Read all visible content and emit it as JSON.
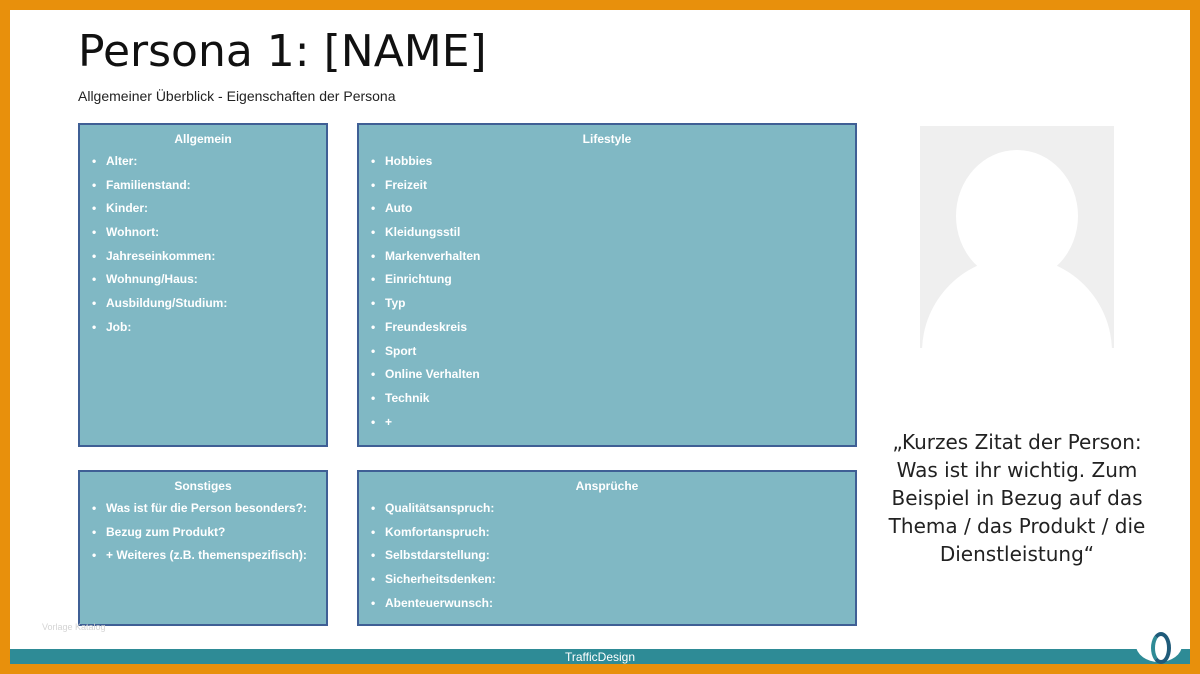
{
  "title": "Persona 1: [NAME]",
  "subtitle": "Allgemeiner Überblick - Eigenschaften der Persona",
  "boxes": {
    "allgemein": {
      "title": "Allgemein",
      "items": [
        "Alter:",
        "Familienstand:",
        "Kinder:",
        "Wohnort:",
        "Jahreseinkommen:",
        "Wohnung/Haus:",
        "Ausbildung/Studium:",
        "Job:"
      ]
    },
    "lifestyle": {
      "title": "Lifestyle",
      "items": [
        "Hobbies",
        "Freizeit",
        "Auto",
        "Kleidungsstil",
        "Markenverhalten",
        "Einrichtung",
        "Typ",
        "Freundeskreis",
        "Sport",
        "Online Verhalten",
        "Technik",
        "+"
      ]
    },
    "sonstiges": {
      "title": "Sonstiges",
      "items": [
        "Was ist für die Person besonders?:",
        "Bezug zum Produkt?",
        "+ Weiteres (z.B. themenspezifisch):"
      ]
    },
    "ansprueche": {
      "title": "Ansprüche",
      "items": [
        "Qualitätsanspruch:",
        "Komfortanspruch:",
        "Selbstdarstellung:",
        "Sicherheitsdenken:",
        "Abenteuerwunsch:"
      ]
    }
  },
  "bullet": "•",
  "quote": "„Kurzes Zitat der Person: Was ist ihr wichtig. Zum Beispiel in Bezug auf das Thema / das Produkt / die Dienstleistung“",
  "watermark": "Vorlage Katalog",
  "footer": "TrafficDesign",
  "colors": {
    "frame": "#e8900c",
    "box_fill": "#80b8c4",
    "box_border": "#3f5f95",
    "footer": "#2e8b96"
  }
}
